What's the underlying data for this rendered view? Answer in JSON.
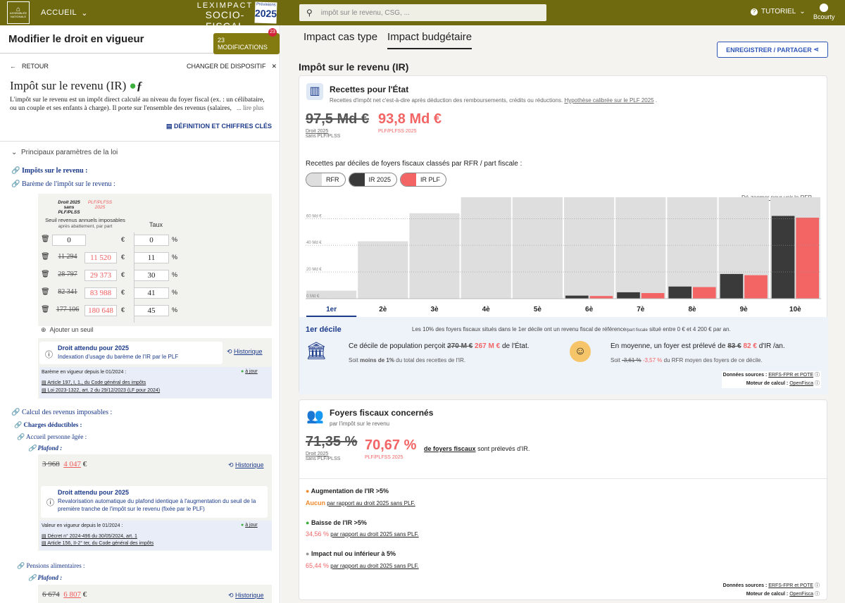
{
  "header": {
    "logo_text": "ASSEMBLÉE NATIONALE",
    "home": "ACCUEIL",
    "brand_line1": "LEXIMPACT",
    "brand_line2": "SOCIO-FISCAL",
    "badge_prev": "Prévisions",
    "badge_year": "2025",
    "search_placeholder": "impôt sur le revenu, CSG, ...",
    "tutorial": "TUTORIEL",
    "user": "Bcourty"
  },
  "left": {
    "title": "Modifier le droit en vigueur",
    "mods_label": "23 MODIFICATIONS",
    "mods_count": "23",
    "back": "RETOUR",
    "change": "CHANGER DE DISPOSITIF",
    "dispositif_title": "Impôt sur le revenu (IR)",
    "description": "L'impôt sur le revenu est un impôt direct calculé au niveau du foyer fiscal (ex. : un célibataire, ou un couple et ses enfants à charge). Il porte sur l'ensemble des revenus (salaires,",
    "read_more": "... lire plus",
    "definition_link": "DÉFINITION ET CHIFFRES CLÉS",
    "params_title": "Principaux paramètres de la loi",
    "impots_label": "Impôts sur le revenu :",
    "bareme_label": "Barème de l'impôt sur le revenu :",
    "col_droit": "Droit 2025 sans PLF/PLSS",
    "col_plf": "PLF/PLFSS 2025",
    "col_seuil": "Seuil revenus annuels imposables",
    "col_seuil_sub": "après abattement, par part",
    "col_taux": "Taux",
    "brackets": [
      {
        "old": "",
        "new": "0",
        "rate": "0"
      },
      {
        "old": "11 294",
        "new": "11 520",
        "rate": "11"
      },
      {
        "old": "28 797",
        "new": "29 373",
        "rate": "30"
      },
      {
        "old": "82 341",
        "new": "83 988",
        "rate": "41"
      },
      {
        "old": "177 106",
        "new": "180 648",
        "rate": "45"
      }
    ],
    "currency": "€",
    "percent": "%",
    "add_seuil": "Ajouter un seuil",
    "expected1_title": "Droit attendu pour 2025",
    "expected1_text": "Indexation d'usage du barème de l'IR par le PLF",
    "historique": "Historique",
    "bareme_vigueur": "Barème en vigueur depuis le 01/2024 :",
    "a_jour": "à jour",
    "ref1": "Article 197, I, 1., du Code général des impôts",
    "ref2": "Loi 2023-1322, art. 2 du 29/12/2023 (LF pour 2024)",
    "calcul_label": "Calcul des revenus imposables :",
    "charges_label": "Charges déductibles :",
    "accueil_label": "Accueil personne âgée :",
    "plafond_label": "Plafond :",
    "plafond_old": "3 968",
    "plafond_new": "4 047",
    "expected2_title": "Droit attendu pour 2025",
    "expected2_text": "Revalorisation automatique du plafond identique à l'augmentation du seuil de la première tranche de l'impôt sur le revenu (fixée par le PLF)",
    "valeur_vigueur": "Valeur en vigueur depuis le 01/2024 :",
    "ref3": "Décret n° 2024-496 du 30/05/2024, art. 1",
    "ref4": "Article 156, II-2° ter, du Code général des impôts",
    "pensions_label": "Pensions alimentaires :",
    "plafond2_old": "6 674",
    "plafond2_new": "6 807"
  },
  "right": {
    "tab1": "Impact cas type",
    "tab2": "Impact budgétaire",
    "share": "ENREGISTRER / PARTAGER",
    "section_title": "Impôt sur le revenu (IR)",
    "recettes_title": "Recettes pour l'État",
    "recettes_sub": "Recettes d'impôt net c'est-à-dire après déduction des remboursements, crédits ou réductions.",
    "recettes_hyp": "Hypothèse calibrée sur le PLF 2025",
    "val_old": "97,5 Md €",
    "val_new": "93,8 Md €",
    "lbl_droit": "Droit 2025",
    "lbl_droit2": "sans PLF/PLSS",
    "lbl_plf": "PLF/PLFSS 2025",
    "deciles_title": "Recettes par déciles de foyers fiscaux classés par RFR / part fiscale :",
    "legend_rfr": "RFR",
    "legend_ir": "IR 2025",
    "legend_plf": "IR PLF",
    "dezoom": "Dé-zoomer pour voir le RFR",
    "decile_label": "1er décile",
    "decile_desc1": "Les 10% des foyers fiscaux situés dans le 1er décile ont un revenu fiscal de référence",
    "decile_desc_sub": "/part fiscale",
    "decile_desc2": "situé entre 0 € et 4 200 € par an.",
    "percoit_a": "Ce décile de population perçoit",
    "percoit_old": "270 M €",
    "percoit_new": "267 M €",
    "percoit_b": "de l'État.",
    "percoit_sub_a": "Soit",
    "percoit_sub_b": "moins de 1%",
    "percoit_sub_c": "du total des recettes de l'IR.",
    "moyenne_a": "En moyenne, un foyer est prélevé de",
    "moyenne_old": "83 €",
    "moyenne_new": "82 €",
    "moyenne_b": "d'IR /an.",
    "moyenne_sub_a": "Soit",
    "moyenne_sub_old": "-3,61 %",
    "moyenne_sub_new": "-3,57 %",
    "moyenne_sub_b": "du RFR moyen des foyers de ce décile.",
    "sources_label": "Données sources :",
    "sources_val": "ERFS-FPR et POTE",
    "moteur_label": "Moteur de calcul :",
    "moteur_val": "OpenFisca",
    "foyers_title": "Foyers fiscaux concernés",
    "foyers_sub": "par l'impôt sur le revenu",
    "foyers_old": "71,35 %",
    "foyers_new": "70,67 %",
    "foyers_link": "de foyers fiscaux",
    "foyers_after": "sont prélevés d'IR.",
    "aug_title": "Augmentation de l'IR >5%",
    "aug_val": "Aucun",
    "aug_text": "par rapport au droit 2025 sans PLF.",
    "baisse_title": "Baisse de l'IR >5%",
    "baisse_val": "34,56 %",
    "baisse_text": "par rapport au droit 2025 sans PLF.",
    "nul_title": "Impact nul ou inférieur à 5%",
    "nul_val": "65,44 %",
    "nul_text": "par rapport au droit 2025 sans PLF."
  },
  "chart_data": {
    "type": "bar",
    "categories": [
      "1er",
      "2è",
      "3è",
      "4è",
      "5è",
      "6è",
      "7è",
      "8è",
      "9è",
      "10è"
    ],
    "yticks": [
      "0 Md €",
      "20 Md €",
      "40 Md €",
      "60 Md €"
    ],
    "ylim": [
      0,
      76
    ],
    "series": [
      {
        "name": "RFR",
        "values": [
          6,
          43,
          64,
          76,
          76,
          76,
          76,
          76,
          76,
          76
        ],
        "color": "#dedede"
      },
      {
        "name": "IR 2025",
        "values": [
          0.27,
          0,
          0,
          0,
          0,
          2.3,
          4.8,
          9.1,
          18.5,
          62
        ],
        "color": "#3a3a3a"
      },
      {
        "name": "IR PLF",
        "values": [
          0.267,
          0,
          0,
          0,
          0,
          2.0,
          4.2,
          8.7,
          17.6,
          60.7
        ],
        "color": "#f36464"
      }
    ],
    "selected": "1er",
    "legend": "top-left"
  }
}
